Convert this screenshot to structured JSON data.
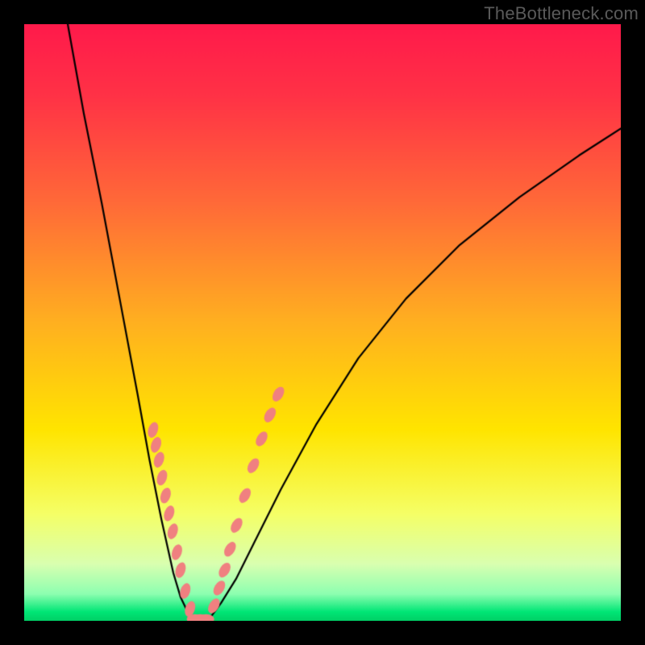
{
  "watermark": "TheBottleneck.com",
  "plot_frame": {
    "bg": "#000000",
    "inner_x": 30,
    "inner_y": 30,
    "inner_w": 740,
    "inner_h": 740
  },
  "gradient_stops": [
    {
      "t": 0.0,
      "color": "#ff1a4b"
    },
    {
      "t": 0.12,
      "color": "#ff3246"
    },
    {
      "t": 0.3,
      "color": "#ff6a38"
    },
    {
      "t": 0.5,
      "color": "#ffb020"
    },
    {
      "t": 0.68,
      "color": "#ffe500"
    },
    {
      "t": 0.82,
      "color": "#f5ff66"
    },
    {
      "t": 0.905,
      "color": "#d9ffb0"
    },
    {
      "t": 0.955,
      "color": "#8dffb0"
    },
    {
      "t": 0.985,
      "color": "#00e676"
    },
    {
      "t": 1.0,
      "color": "#00d065"
    }
  ],
  "chart_data": {
    "type": "line",
    "title": "",
    "xlabel": "",
    "ylabel": "",
    "xlim": [
      0,
      1
    ],
    "ylim": [
      0,
      1
    ],
    "note": "Values are normalized to the plot area; y is measured from the top (0) to the bottom (1). Estimated from pixels.",
    "series": [
      {
        "name": "left-curve",
        "x": [
          0.073,
          0.1,
          0.13,
          0.16,
          0.19,
          0.21,
          0.23,
          0.25,
          0.262,
          0.274,
          0.286
        ],
        "y": [
          0.0,
          0.15,
          0.3,
          0.46,
          0.62,
          0.73,
          0.83,
          0.92,
          0.96,
          0.985,
          0.997
        ]
      },
      {
        "name": "right-curve",
        "x": [
          0.31,
          0.33,
          0.355,
          0.385,
          0.43,
          0.49,
          0.56,
          0.64,
          0.73,
          0.83,
          0.93,
          1.0
        ],
        "y": [
          0.997,
          0.97,
          0.93,
          0.87,
          0.78,
          0.67,
          0.56,
          0.46,
          0.37,
          0.29,
          0.22,
          0.175
        ]
      }
    ],
    "flat_bottom": {
      "x0": 0.286,
      "x1": 0.31,
      "y": 0.997
    },
    "marker_clusters": [
      {
        "name": "left-descending-markers",
        "color": "#f08080",
        "points": [
          {
            "x": 0.216,
            "y": 0.68
          },
          {
            "x": 0.221,
            "y": 0.705
          },
          {
            "x": 0.226,
            "y": 0.73
          },
          {
            "x": 0.231,
            "y": 0.76
          },
          {
            "x": 0.237,
            "y": 0.79
          },
          {
            "x": 0.243,
            "y": 0.82
          },
          {
            "x": 0.249,
            "y": 0.85
          },
          {
            "x": 0.256,
            "y": 0.885
          },
          {
            "x": 0.262,
            "y": 0.915
          },
          {
            "x": 0.27,
            "y": 0.95
          },
          {
            "x": 0.278,
            "y": 0.98
          }
        ]
      },
      {
        "name": "bottom-markers",
        "color": "#f08080",
        "points": [
          {
            "x": 0.286,
            "y": 0.997
          },
          {
            "x": 0.295,
            "y": 0.997
          },
          {
            "x": 0.305,
            "y": 0.997
          }
        ]
      },
      {
        "name": "right-ascending-markers",
        "color": "#f08080",
        "points": [
          {
            "x": 0.318,
            "y": 0.975
          },
          {
            "x": 0.327,
            "y": 0.945
          },
          {
            "x": 0.336,
            "y": 0.915
          },
          {
            "x": 0.345,
            "y": 0.88
          },
          {
            "x": 0.356,
            "y": 0.84
          },
          {
            "x": 0.37,
            "y": 0.79
          },
          {
            "x": 0.384,
            "y": 0.74
          },
          {
            "x": 0.398,
            "y": 0.695
          },
          {
            "x": 0.412,
            "y": 0.655
          },
          {
            "x": 0.426,
            "y": 0.62
          }
        ]
      }
    ],
    "curve_stroke": "#000000",
    "curve_width": 2.2
  }
}
